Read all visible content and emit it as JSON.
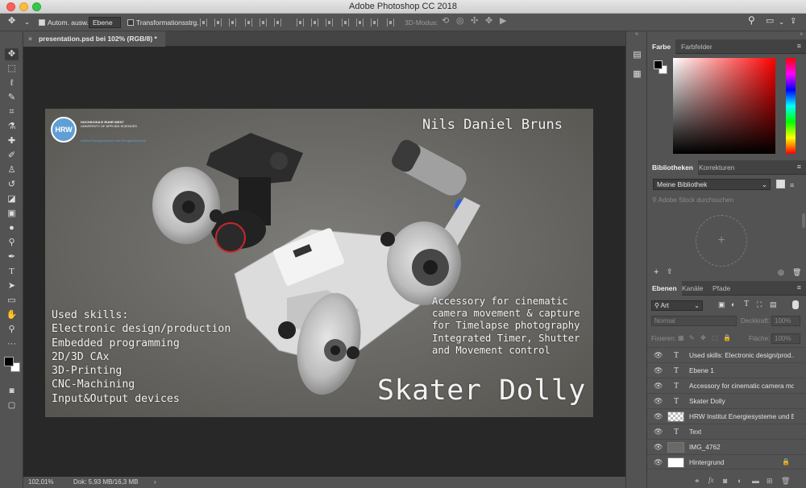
{
  "window": {
    "title": "Adobe Photoshop CC 2018"
  },
  "options": {
    "auto_select_label": "Autom. ausw.:",
    "auto_select_value": "Ebene",
    "transform_label": "Transformationsstrg.",
    "mode_3d_label": "3D-Modus:"
  },
  "document": {
    "tab_label": "presentation.psd bei 102% (RGB/8) *",
    "zoom": "102,01%",
    "doc_size": "Dok: 5,93 MB/16,3 MB"
  },
  "canvas": {
    "logo_text": "HRW",
    "logo_line1": "HOCHSCHULE RUHR WEST",
    "logo_line2": "UNIVERSITY OF APPLIED SCIENCES",
    "logo_line3": "Institut Energiesysteme und Energiewirtschaft",
    "author": "Nils Daniel Bruns",
    "skills_title": "Used skills:",
    "skills": [
      "Electronic design/production",
      "Embedded programming",
      "2D/3D CAx",
      "3D-Printing",
      "CNC-Machining",
      "Input&Output devices"
    ],
    "description": [
      "Accessory for cinematic",
      "camera movement & capture",
      "for Timelapse photography",
      "Integrated Timer, Shutter",
      "and Movement control"
    ],
    "project_title": "Skater Dolly"
  },
  "color_panel": {
    "tab_color": "Farbe",
    "tab_swatches": "Farbfelder"
  },
  "library_panel": {
    "tab_libraries": "Bibliotheken",
    "tab_adjustments": "Korrekturen",
    "library_select": "Meine Bibliothek",
    "search_placeholder": "Adobe Stock durchsuchen"
  },
  "layers_panel": {
    "tab_layers": "Ebenen",
    "tab_channels": "Kanäle",
    "tab_paths": "Pfade",
    "filter_kind": "Art",
    "blend_mode": "Normal",
    "opacity_label": "Deckkraft:",
    "opacity_value": "100%",
    "lock_label": "Fixieren:",
    "fill_label": "Fläche:",
    "fill_value": "100%",
    "layers": [
      {
        "name": "Used skills: Electronic design/prod...",
        "type": "text"
      },
      {
        "name": "Ebene 1",
        "type": "text"
      },
      {
        "name": "Accessory for cinematic camera mo...",
        "type": "text"
      },
      {
        "name": "Skater Dolly",
        "type": "text"
      },
      {
        "name": "HRW Institut Energiesysteme und E...",
        "type": "image"
      },
      {
        "name": "Text",
        "type": "text"
      },
      {
        "name": "IMG_4762",
        "type": "smart"
      },
      {
        "name": "Hintergrund",
        "type": "background"
      }
    ]
  },
  "colors": {
    "foreground": "#000000",
    "background": "#ffffff",
    "accent": "#5f9fd6"
  }
}
